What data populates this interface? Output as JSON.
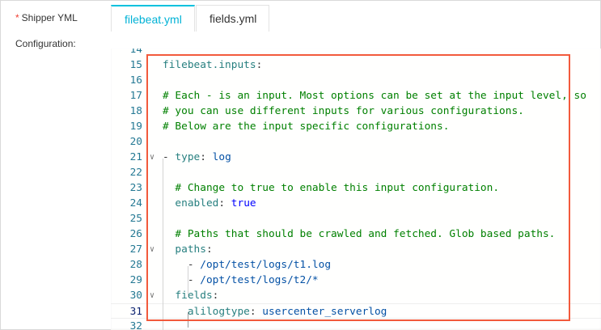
{
  "form": {
    "shipper_label": "Shipper YML",
    "required_mark": "*",
    "configuration_label": "Configuration:"
  },
  "tabs": [
    {
      "label": "filebeat.yml",
      "active": true
    },
    {
      "label": "fields.yml",
      "active": false
    }
  ],
  "editor": {
    "lines": [
      {
        "n": "14",
        "tokens": []
      },
      {
        "n": "15",
        "tokens": [
          [
            "key",
            "filebeat.inputs"
          ],
          [
            "punc",
            ":"
          ]
        ]
      },
      {
        "n": "16",
        "tokens": []
      },
      {
        "n": "17",
        "tokens": [
          [
            "com",
            "# Each - is an input. Most options can be set at the input level, so"
          ]
        ]
      },
      {
        "n": "18",
        "tokens": [
          [
            "com",
            "# you can use different inputs for various configurations."
          ]
        ]
      },
      {
        "n": "19",
        "tokens": [
          [
            "com",
            "# Below are the input specific configurations."
          ]
        ]
      },
      {
        "n": "20",
        "tokens": []
      },
      {
        "n": "21",
        "fold": true,
        "tokens": [
          [
            "punc",
            "- "
          ],
          [
            "key",
            "type"
          ],
          [
            "punc",
            ": "
          ],
          [
            "val",
            "log"
          ]
        ]
      },
      {
        "n": "22",
        "tokens": []
      },
      {
        "n": "23",
        "tokens": [
          [
            "punc",
            "  "
          ],
          [
            "com",
            "# Change to true to enable this input configuration."
          ]
        ]
      },
      {
        "n": "24",
        "tokens": [
          [
            "punc",
            "  "
          ],
          [
            "key",
            "enabled"
          ],
          [
            "punc",
            ": "
          ],
          [
            "bool",
            "true"
          ]
        ]
      },
      {
        "n": "25",
        "tokens": []
      },
      {
        "n": "26",
        "tokens": [
          [
            "punc",
            "  "
          ],
          [
            "com",
            "# Paths that should be crawled and fetched. Glob based paths."
          ]
        ]
      },
      {
        "n": "27",
        "fold": true,
        "tokens": [
          [
            "punc",
            "  "
          ],
          [
            "key",
            "paths"
          ],
          [
            "punc",
            ":"
          ]
        ]
      },
      {
        "n": "28",
        "tokens": [
          [
            "punc",
            "    - "
          ],
          [
            "val",
            "/opt/test/logs/t1.log"
          ]
        ]
      },
      {
        "n": "29",
        "tokens": [
          [
            "punc",
            "    - "
          ],
          [
            "val",
            "/opt/test/logs/t2/*"
          ]
        ]
      },
      {
        "n": "30",
        "fold": true,
        "tokens": [
          [
            "punc",
            "  "
          ],
          [
            "key",
            "fields"
          ],
          [
            "punc",
            ":"
          ]
        ]
      },
      {
        "n": "31",
        "current": true,
        "tokens": [
          [
            "punc",
            "    "
          ],
          [
            "key",
            "alilogtype"
          ],
          [
            "punc",
            ": "
          ],
          [
            "val",
            "usercenter_serverlog"
          ]
        ]
      },
      {
        "n": "32",
        "tokens": []
      }
    ],
    "highlight_color": "#f25a3c"
  }
}
